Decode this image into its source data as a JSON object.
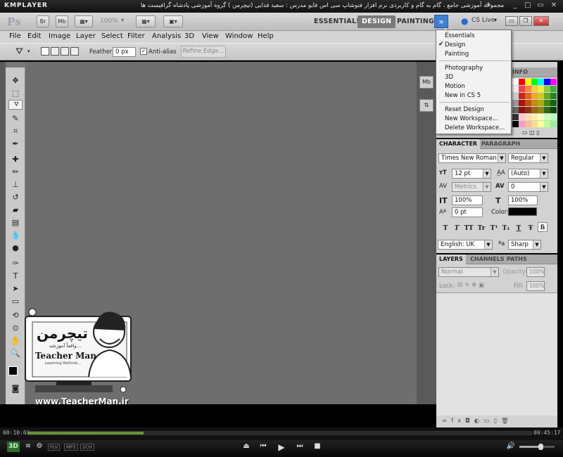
{
  "player": {
    "logo": "KMPLAYER",
    "title": "مجموعه آموزشی جامع ، گام به گام و کاربردی نرم افزار فتوشاپ سی اس فایو  مدرس : سعید فدایی (تیچرمن ) گروه آموزشی پادشاه گرافیست ها",
    "time_current": "00:10:00",
    "time_total": "00:45:17",
    "progress_fraction": 0.23,
    "format_badges": [
      "FLV",
      "MP3",
      "2CH"
    ],
    "btn_3d": "3D"
  },
  "app": {
    "logo": "Ps",
    "bridge": "Br",
    "minibridge": "Mb",
    "zoom": "100%",
    "workspaces": [
      "ESSENTIALS",
      "DESIGN",
      "PAINTING"
    ],
    "active_workspace": "DESIGN",
    "cs_live": "CS Live"
  },
  "menu": [
    "File",
    "Edit",
    "Image",
    "Layer",
    "Select",
    "Filter",
    "Analysis",
    "3D",
    "View",
    "Window",
    "Help"
  ],
  "options": {
    "feather_label": "Feather:",
    "feather_value": "0 px",
    "antialias_label": "Anti-alias",
    "refine_label": "Refine Edge..."
  },
  "workspace_menu": {
    "items": [
      "Essentials",
      "Design",
      "Painting",
      "Photography",
      "3D",
      "Motion",
      "New in CS 5",
      "Reset Design",
      "New Workspace...",
      "Delete Workspace..."
    ],
    "checked": "Design"
  },
  "swatches_panel": {
    "tab": "INFO"
  },
  "character": {
    "tabs": [
      "CHARACTER",
      "PARAGRAPH"
    ],
    "font_family": "Times New Roman",
    "font_style": "Regular",
    "font_size": "12 pt",
    "leading": "(Auto)",
    "kerning": "Metrics",
    "tracking": "0",
    "vscale": "100%",
    "hscale": "100%",
    "baseline": "0 pt",
    "color_label": "Color:",
    "type_buttons": [
      "T",
      "T",
      "TT",
      "Tr",
      "T¹",
      "T₁",
      "T",
      "Ŧ",
      "fi"
    ],
    "language": "English: UK",
    "aa_label": "ªa",
    "antialias": "Sharp"
  },
  "layers": {
    "tabs": [
      "LAYERS",
      "CHANNELS",
      "PATHS"
    ],
    "blend": "Normal",
    "opacity_label": "Opacity:",
    "opacity": "100%",
    "lock_label": "Lock:",
    "fill_label": "Fill:",
    "fill": "100%"
  },
  "watermark": {
    "brand_fa": "تیچرمن",
    "brand_sub": "واقعاً آموزشه...",
    "brand_en": "Teacher Man",
    "tagline": "Learning Rethink...",
    "url": "www.TeacherMan.ir"
  }
}
